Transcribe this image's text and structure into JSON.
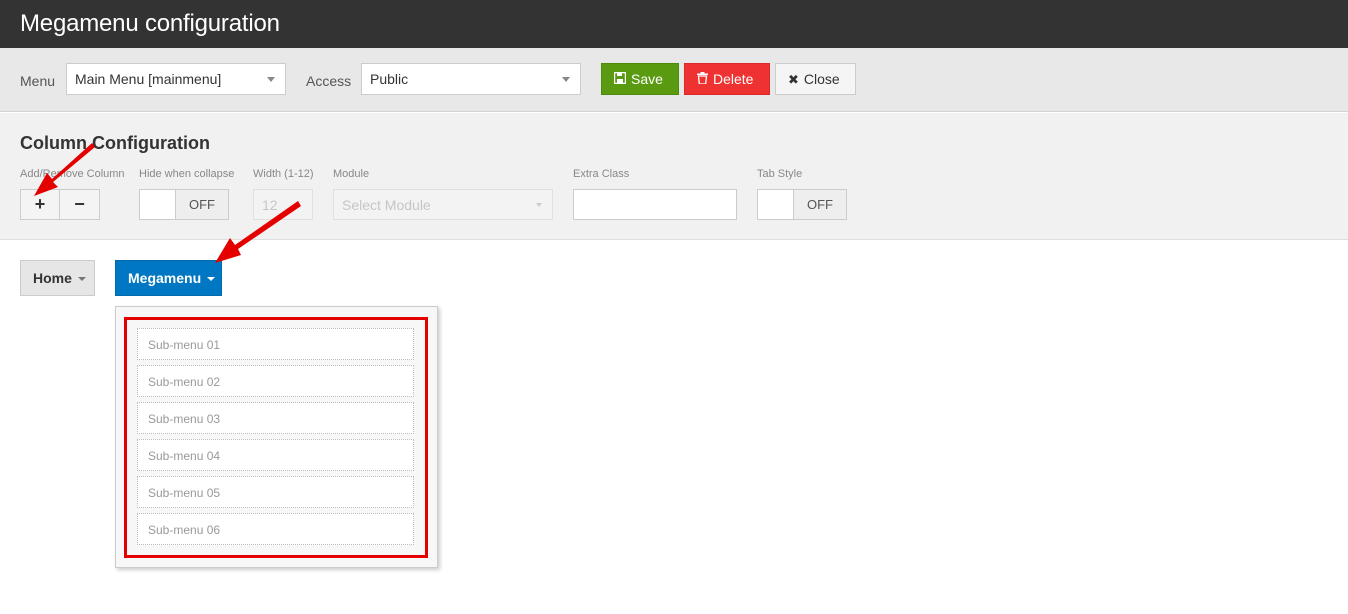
{
  "window": {
    "title": "Megamenu configuration"
  },
  "toolbar": {
    "menu_label": "Menu",
    "menu_value": "Main Menu [mainmenu]",
    "access_label": "Access",
    "access_value": "Public",
    "save_label": "Save",
    "delete_label": "Delete",
    "close_label": "Close"
  },
  "column_config": {
    "title": "Column Configuration",
    "add_remove_label": "Add/Remove Column",
    "add_symbol": "+",
    "remove_symbol": "−",
    "hide_label": "Hide when collapse",
    "hide_state": "OFF",
    "width_label": "Width (1-12)",
    "width_value": "12",
    "module_label": "Module",
    "module_placeholder": "Select Module",
    "extra_class_label": "Extra Class",
    "extra_class_value": "",
    "tab_style_label": "Tab Style",
    "tab_style_state": "OFF"
  },
  "nav": {
    "home_label": "Home",
    "megamenu_label": "Megamenu"
  },
  "submenu": {
    "items": [
      "Sub-menu 01",
      "Sub-menu 02",
      "Sub-menu 03",
      "Sub-menu 04",
      "Sub-menu 05",
      "Sub-menu 06"
    ]
  },
  "colors": {
    "titlebar": "#333333",
    "save": "#5a9a11",
    "delete": "#ee3131",
    "megamenu_active": "#0077c2",
    "annotation": "#e50000"
  }
}
